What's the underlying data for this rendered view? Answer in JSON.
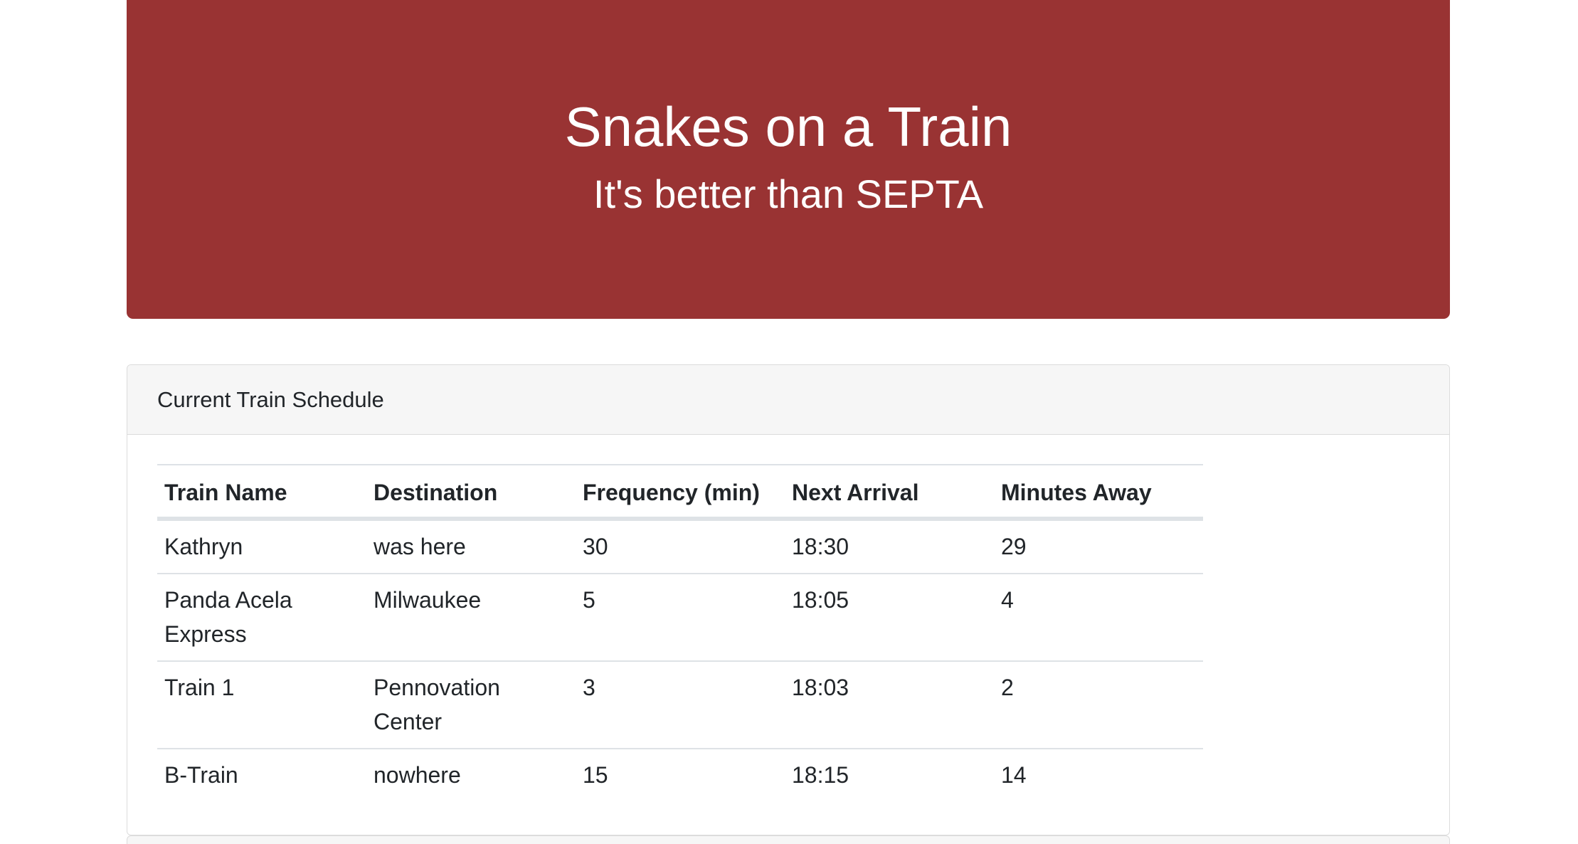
{
  "header": {
    "title": "Snakes on a Train",
    "subtitle": "It's better than SEPTA",
    "background_color": "#993333"
  },
  "schedule": {
    "heading": "Current Train Schedule",
    "columns": [
      "Train Name",
      "Destination",
      "Frequency (min)",
      "Next Arrival",
      "Minutes Away"
    ],
    "rows": [
      [
        "Kathryn",
        "was here",
        "30",
        "18:30",
        "29"
      ],
      [
        "Panda Acela Express",
        "Milwaukee",
        "5",
        "18:05",
        "4"
      ],
      [
        "Train 1",
        "Pennovation Center",
        "3",
        "18:03",
        "2"
      ],
      [
        "B-Train",
        "nowhere",
        "15",
        "18:15",
        "14"
      ]
    ]
  }
}
